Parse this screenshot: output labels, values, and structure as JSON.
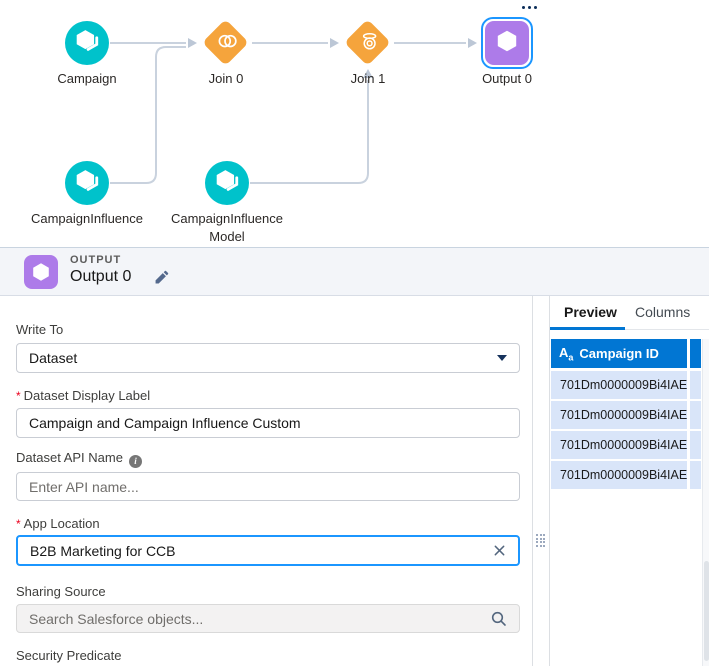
{
  "graph": {
    "nodes": [
      {
        "label": "Campaign",
        "type": "dataset"
      },
      {
        "label": "Join 0",
        "type": "join"
      },
      {
        "label": "Join 1",
        "type": "join"
      },
      {
        "label": "Output 0",
        "type": "output",
        "selected": true
      },
      {
        "label": "CampaignInfluence",
        "type": "dataset"
      },
      {
        "label": "CampaignInfluence Model",
        "type": "dataset"
      }
    ]
  },
  "detail_header": {
    "type_label": "OUTPUT",
    "title": "Output 0"
  },
  "form": {
    "required_marker": "*",
    "write_to": {
      "label": "Write To",
      "value": "Dataset"
    },
    "dataset_display_label": {
      "label": "Dataset Display Label",
      "value": "Campaign and Campaign Influence Custom"
    },
    "dataset_api_name": {
      "label": "Dataset API Name",
      "placeholder": "Enter API name..."
    },
    "app_location": {
      "label": "App Location",
      "value": "B2B Marketing for CCB"
    },
    "sharing_source": {
      "label": "Sharing Source",
      "placeholder": "Search Salesforce objects..."
    },
    "security_predicate": {
      "label": "Security Predicate"
    }
  },
  "preview": {
    "tabs": [
      {
        "label": "Preview"
      },
      {
        "label": "Columns"
      }
    ],
    "column": {
      "type_icon_main": "A",
      "type_icon_sub": "a",
      "header": "Campaign ID"
    },
    "rows": [
      "701Dm0000009Bi4IAE",
      "701Dm0000009Bi4IAE",
      "701Dm0000009Bi4IAE",
      "701Dm0000009Bi4IAE"
    ]
  },
  "colors": {
    "dataset_teal": "#00C2CB",
    "join_orange": "#F5A43C",
    "output_purple": "#AD7BE9",
    "selection_blue": "#1B96FF",
    "column_header_blue": "#0176D3",
    "row_blue": "#D9E5F9",
    "connector_gray": "#C9D2DE"
  }
}
